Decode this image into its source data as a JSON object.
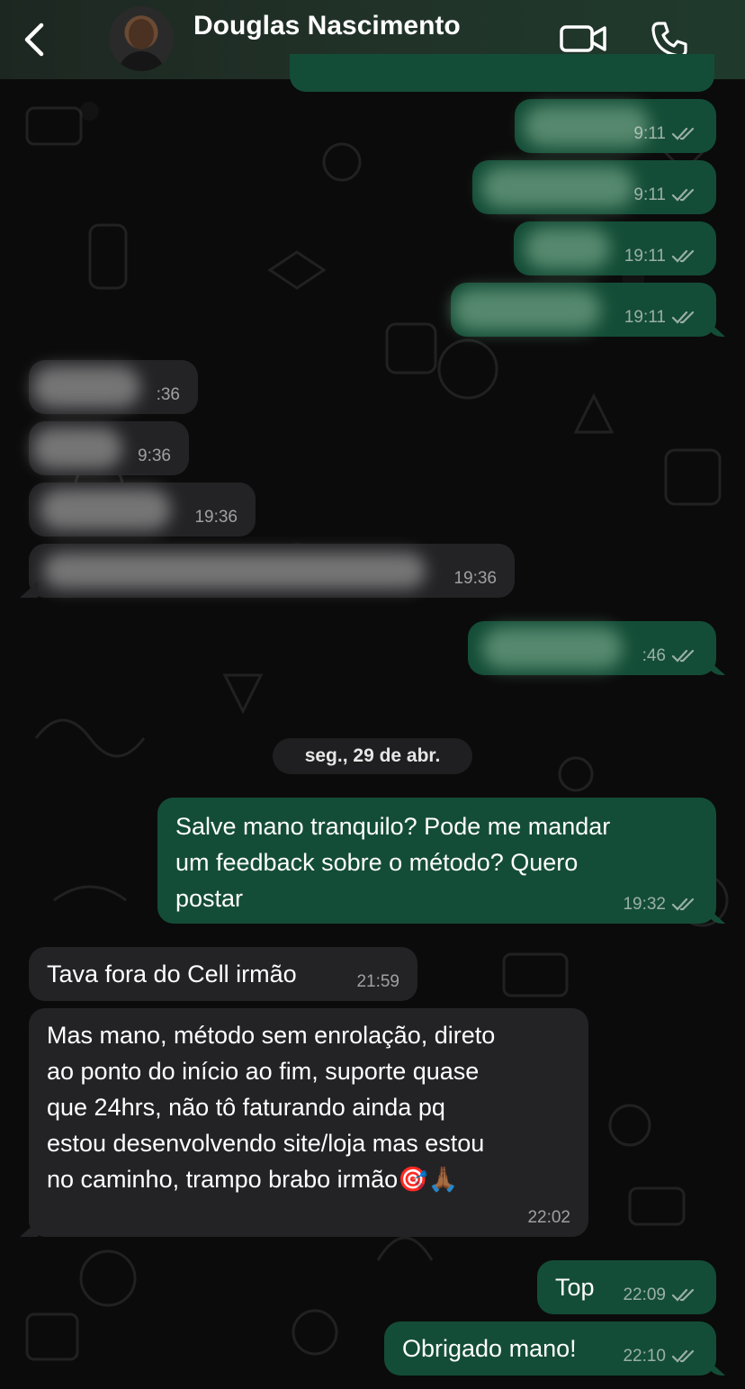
{
  "header": {
    "back_icon": "chevron-left-icon",
    "contact_name": "Douglas Nascimento",
    "video_icon": "video-camera-icon",
    "call_icon": "phone-icon"
  },
  "colors": {
    "outgoing_bubble": "#144d37",
    "incoming_bubble": "#232326",
    "header_bg": "#213329",
    "chat_bg": "#0b0b0b"
  },
  "messages_before_date": [
    {
      "direction": "out",
      "time": "9:11",
      "blurred": true
    },
    {
      "direction": "out",
      "time": "9:11",
      "blurred": true
    },
    {
      "direction": "out",
      "time": "19:11",
      "blurred": true
    },
    {
      "direction": "out",
      "time": "19:11",
      "blurred": true
    },
    {
      "direction": "in",
      "time": ":36",
      "blurred": true
    },
    {
      "direction": "in",
      "time": "9:36",
      "blurred": true
    },
    {
      "direction": "in",
      "time": "19:36",
      "blurred": true
    },
    {
      "direction": "in",
      "time": "19:36",
      "blurred": true
    },
    {
      "direction": "out",
      "time": ":46",
      "blurred": true
    }
  ],
  "date_separator": "seg., 29 de abr.",
  "messages": [
    {
      "direction": "out",
      "text_lines": [
        "Salve mano tranquilo? Pode me mandar",
        "um feedback sobre o método? Quero",
        "postar"
      ],
      "time": "19:32"
    },
    {
      "direction": "in",
      "text": "Tava fora do Cell irmão",
      "time": "21:59"
    },
    {
      "direction": "in",
      "text_lines": [
        "Mas mano, método sem enrolação, direto",
        "ao ponto do início ao fim, suporte quase",
        "que 24hrs, não tô faturando ainda pq",
        "estou desenvolvendo site/loja mas estou",
        "no caminho, trampo brabo irmão🎯🙏🏾"
      ],
      "time": "22:02"
    },
    {
      "direction": "out",
      "text": "Top",
      "time": "22:09"
    },
    {
      "direction": "out",
      "text": "Obrigado mano!",
      "time": "22:10"
    }
  ]
}
